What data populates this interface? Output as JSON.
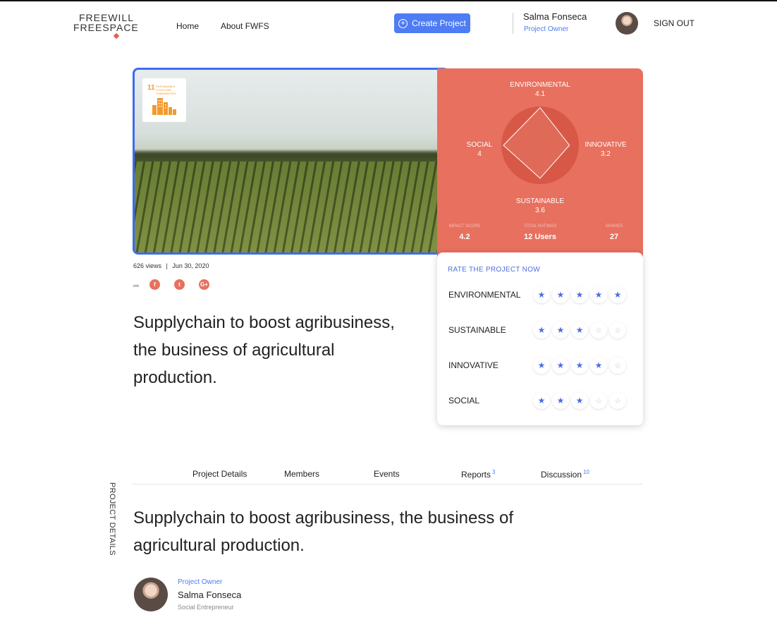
{
  "brand": {
    "line1": "FREEWILL",
    "line2": "FREESPACE"
  },
  "nav": {
    "home": "Home",
    "about": "About FWFS"
  },
  "header": {
    "create_label": "Create Project",
    "user_name": "Salma Fonseca",
    "user_role": "Project Owner",
    "sign_out": "SIGN OUT"
  },
  "hero": {
    "sdg_number": "11",
    "sdg_text": "SUSTAINABLE CITIES AND COMMUNITIES",
    "image": "farm-field-image"
  },
  "scores": {
    "environmental": {
      "label": "ENVIRONMENTAL",
      "value": "4.1"
    },
    "social": {
      "label": "SOCIAL",
      "value": "4"
    },
    "innovative": {
      "label": "INNOVATIVE",
      "value": "3.2"
    },
    "sustainable": {
      "label": "SUSTAINABLE",
      "value": "3.6"
    },
    "stats": {
      "impact_label": "IMPACT SCORE",
      "impact_value": "4.2",
      "ratings_label": "TOTAL RATINGS",
      "ratings_value": "12 Users",
      "shares_label": "SHARES",
      "shares_value": "27"
    },
    "color": "#e8705e"
  },
  "rating": {
    "title": "RATE THE PROJECT NOW",
    "rows": [
      {
        "name": "ENVIRONMENTAL",
        "stars": 5
      },
      {
        "name": "SUSTAINABLE",
        "stars": 3
      },
      {
        "name": "INNOVATIVE",
        "stars": 4
      },
      {
        "name": "SOCIAL",
        "stars": 3
      }
    ],
    "max_stars": 5,
    "star_color": "#4d6fe0"
  },
  "meta": {
    "views": "626 views",
    "separator": "|",
    "date": "Jun 30, 2020"
  },
  "social": {
    "facebook": "f",
    "twitter": "t",
    "google": "G+"
  },
  "headline": "Supplychain to boost agribusiness, the business of agricultural production.",
  "tabs": [
    {
      "label": "Project Details",
      "count": ""
    },
    {
      "label": "Members",
      "count": ""
    },
    {
      "label": "Events",
      "count": ""
    },
    {
      "label": "Reports",
      "count": "3"
    },
    {
      "label": "Discussion",
      "count": "10"
    }
  ],
  "section_label": "PROJECT DETAILS",
  "details": {
    "headline": "Supplychain to boost agribusiness, the business of agricultural production.",
    "owner_role": "Project Owner",
    "owner_name": "Salma Fonseca",
    "owner_title": "Social Entrepreneur"
  },
  "accent_color": "#4d7cf4"
}
